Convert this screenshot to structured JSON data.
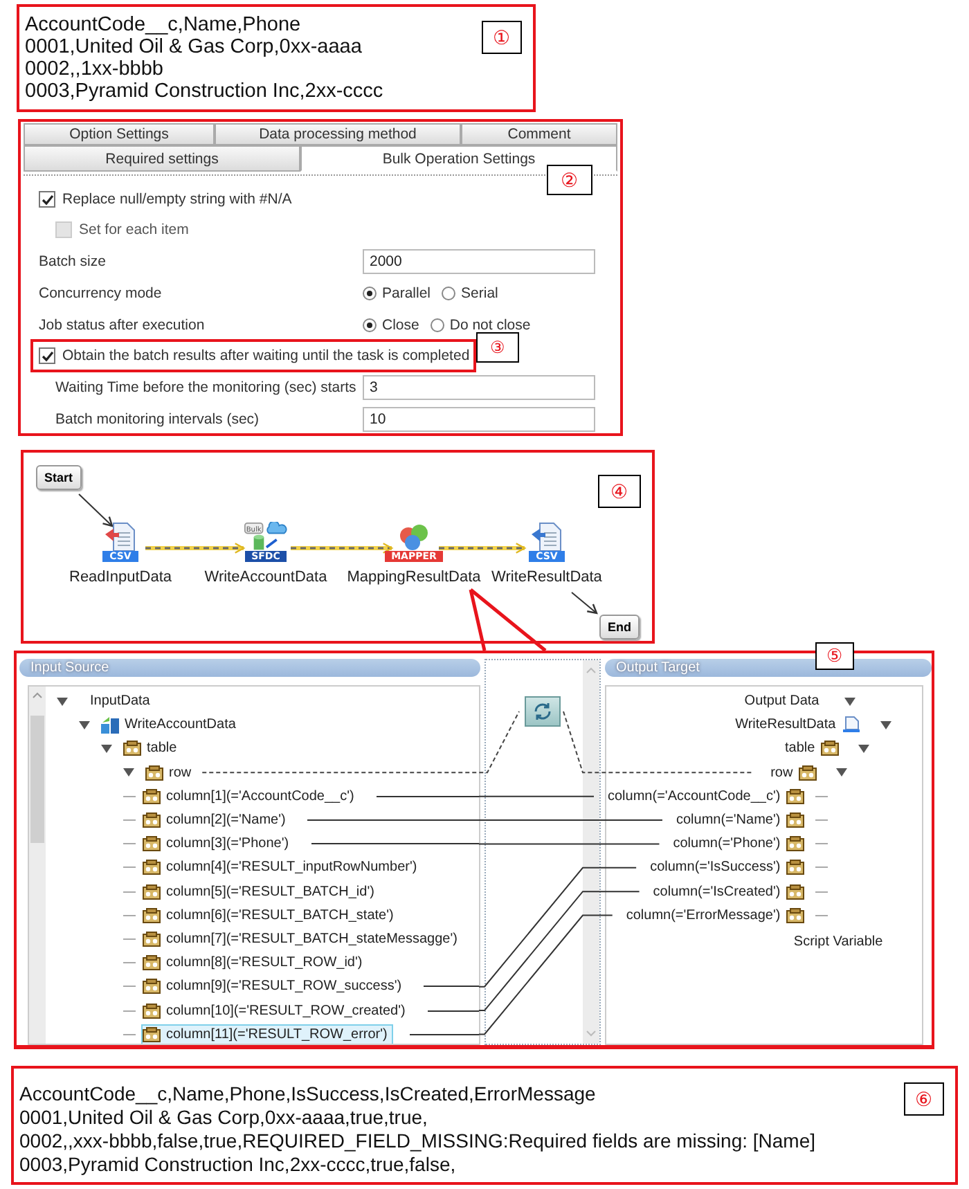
{
  "input_csv": {
    "marker": "①",
    "lines": [
      "AccountCode__c,Name,Phone",
      "0001,United Oil & Gas Corp,0xx-aaaa",
      "0002,,1xx-bbbb",
      "0003,Pyramid Construction Inc,2xx-cccc"
    ]
  },
  "settings": {
    "marker": "②",
    "tab_rows": [
      [
        {
          "label": "Option Settings",
          "selected": false
        },
        {
          "label": "Data processing method",
          "selected": false
        },
        {
          "label": "Comment",
          "selected": false
        }
      ],
      [
        {
          "label": "Required settings",
          "selected": false
        },
        {
          "label": "Bulk Operation Settings",
          "selected": true
        }
      ]
    ],
    "fields": [
      {
        "kind": "checkbox",
        "label": "Replace null/empty string with #N/A",
        "checked": true,
        "disabled": false,
        "children": [
          {
            "kind": "checkbox",
            "label": "Set for each item",
            "checked": false,
            "disabled": true
          }
        ]
      },
      {
        "kind": "text",
        "label": "Batch size",
        "value": "2000"
      },
      {
        "kind": "radio",
        "label": "Concurrency mode",
        "options": [
          {
            "label": "Parallel",
            "selected": true
          },
          {
            "label": "Serial",
            "selected": false
          }
        ]
      },
      {
        "kind": "radio",
        "label": "Job status after execution",
        "options": [
          {
            "label": "Close",
            "selected": true
          },
          {
            "label": "Do not close",
            "selected": false
          }
        ]
      },
      {
        "kind": "checkbox",
        "label": "Obtain the batch results after waiting until the task is completed",
        "checked": true,
        "disabled": false,
        "marker": "③",
        "children": [
          {
            "kind": "text",
            "label": "Waiting Time before the monitoring (sec) starts",
            "value": "3"
          },
          {
            "kind": "text",
            "label": "Batch monitoring intervals (sec)",
            "value": "10"
          }
        ]
      }
    ]
  },
  "flow": {
    "marker": "④",
    "start": "Start",
    "end": "End",
    "nodes": [
      {
        "kind": "csv-read",
        "badge": "CSV",
        "label": "ReadInputData"
      },
      {
        "kind": "sfdc",
        "badge": "SFDC",
        "tag": "Bulk",
        "label": "WriteAccountData"
      },
      {
        "kind": "mapper",
        "badge": "MAPPER",
        "label": "MappingResultData"
      },
      {
        "kind": "csv-write",
        "badge": "CSV",
        "label": "WriteResultData"
      }
    ]
  },
  "mapping": {
    "marker": "⑤",
    "input": {
      "title": "Input Source",
      "tree": [
        {
          "kind": "root",
          "label": "InputData",
          "expanded": true,
          "children": [
            {
              "kind": "component",
              "label": "WriteAccountData",
              "expanded": true,
              "children": [
                {
                  "kind": "table",
                  "label": "table",
                  "expanded": true,
                  "children": [
                    {
                      "kind": "table",
                      "label": "row",
                      "expanded": true,
                      "children": [
                        {
                          "kind": "column",
                          "label": "column[1](='AccountCode__c')",
                          "selected": false,
                          "mapped": true
                        },
                        {
                          "kind": "column",
                          "label": "column[2](='Name')",
                          "selected": false,
                          "mapped": true
                        },
                        {
                          "kind": "column",
                          "label": "column[3](='Phone')",
                          "selected": false,
                          "mapped": true
                        },
                        {
                          "kind": "column",
                          "label": "column[4](='RESULT_inputRowNumber')",
                          "selected": false,
                          "mapped": false
                        },
                        {
                          "kind": "column",
                          "label": "column[5](='RESULT_BATCH_id')",
                          "selected": false,
                          "mapped": false
                        },
                        {
                          "kind": "column",
                          "label": "column[6](='RESULT_BATCH_state')",
                          "selected": false,
                          "mapped": false
                        },
                        {
                          "kind": "column",
                          "label": "column[7](='RESULT_BATCH_stateMessagge')",
                          "selected": false,
                          "mapped": false
                        },
                        {
                          "kind": "column",
                          "label": "column[8](='RESULT_ROW_id')",
                          "selected": false,
                          "mapped": false
                        },
                        {
                          "kind": "column",
                          "label": "column[9](='RESULT_ROW_success')",
                          "selected": false,
                          "mapped": true
                        },
                        {
                          "kind": "column",
                          "label": "column[10](='RESULT_ROW_created')",
                          "selected": false,
                          "mapped": true
                        },
                        {
                          "kind": "column",
                          "label": "column[11](='RESULT_ROW_error')",
                          "selected": true,
                          "mapped": true
                        }
                      ]
                    }
                  ]
                }
              ]
            }
          ]
        }
      ]
    },
    "output": {
      "title": "Output Target",
      "tree": [
        {
          "kind": "root",
          "label": "Output Data",
          "expanded": true,
          "children": [
            {
              "kind": "file",
              "label": "WriteResultData",
              "expanded": true,
              "children": [
                {
                  "kind": "table",
                  "label": "table",
                  "expanded": true,
                  "children": [
                    {
                      "kind": "table",
                      "label": "row",
                      "expanded": true,
                      "children": [
                        {
                          "kind": "column",
                          "label": "column(='AccountCode__c')",
                          "selected": false
                        },
                        {
                          "kind": "column",
                          "label": "column(='Name')",
                          "selected": false
                        },
                        {
                          "kind": "column",
                          "label": "column(='Phone')",
                          "selected": false
                        },
                        {
                          "kind": "column",
                          "label": "column(='IsSuccess')",
                          "selected": false
                        },
                        {
                          "kind": "column",
                          "label": "column(='IsCreated')",
                          "selected": false
                        },
                        {
                          "kind": "column",
                          "label": "column(='ErrorMessage')",
                          "selected": false
                        }
                      ]
                    }
                  ]
                }
              ]
            }
          ]
        }
      ],
      "extra": "Script Variable"
    }
  },
  "output_csv": {
    "marker": "⑥",
    "lines": [
      "AccountCode__c,Name,Phone,IsSuccess,IsCreated,ErrorMessage",
      "0001,United Oil & Gas Corp,0xx-aaaa,true,true,",
      "0002,,xxx-bbbb,false,true,REQUIRED_FIELD_MISSING:Required fields are missing: [Name]",
      "0003,Pyramid Construction Inc,2xx-cccc,true,false,"
    ]
  }
}
